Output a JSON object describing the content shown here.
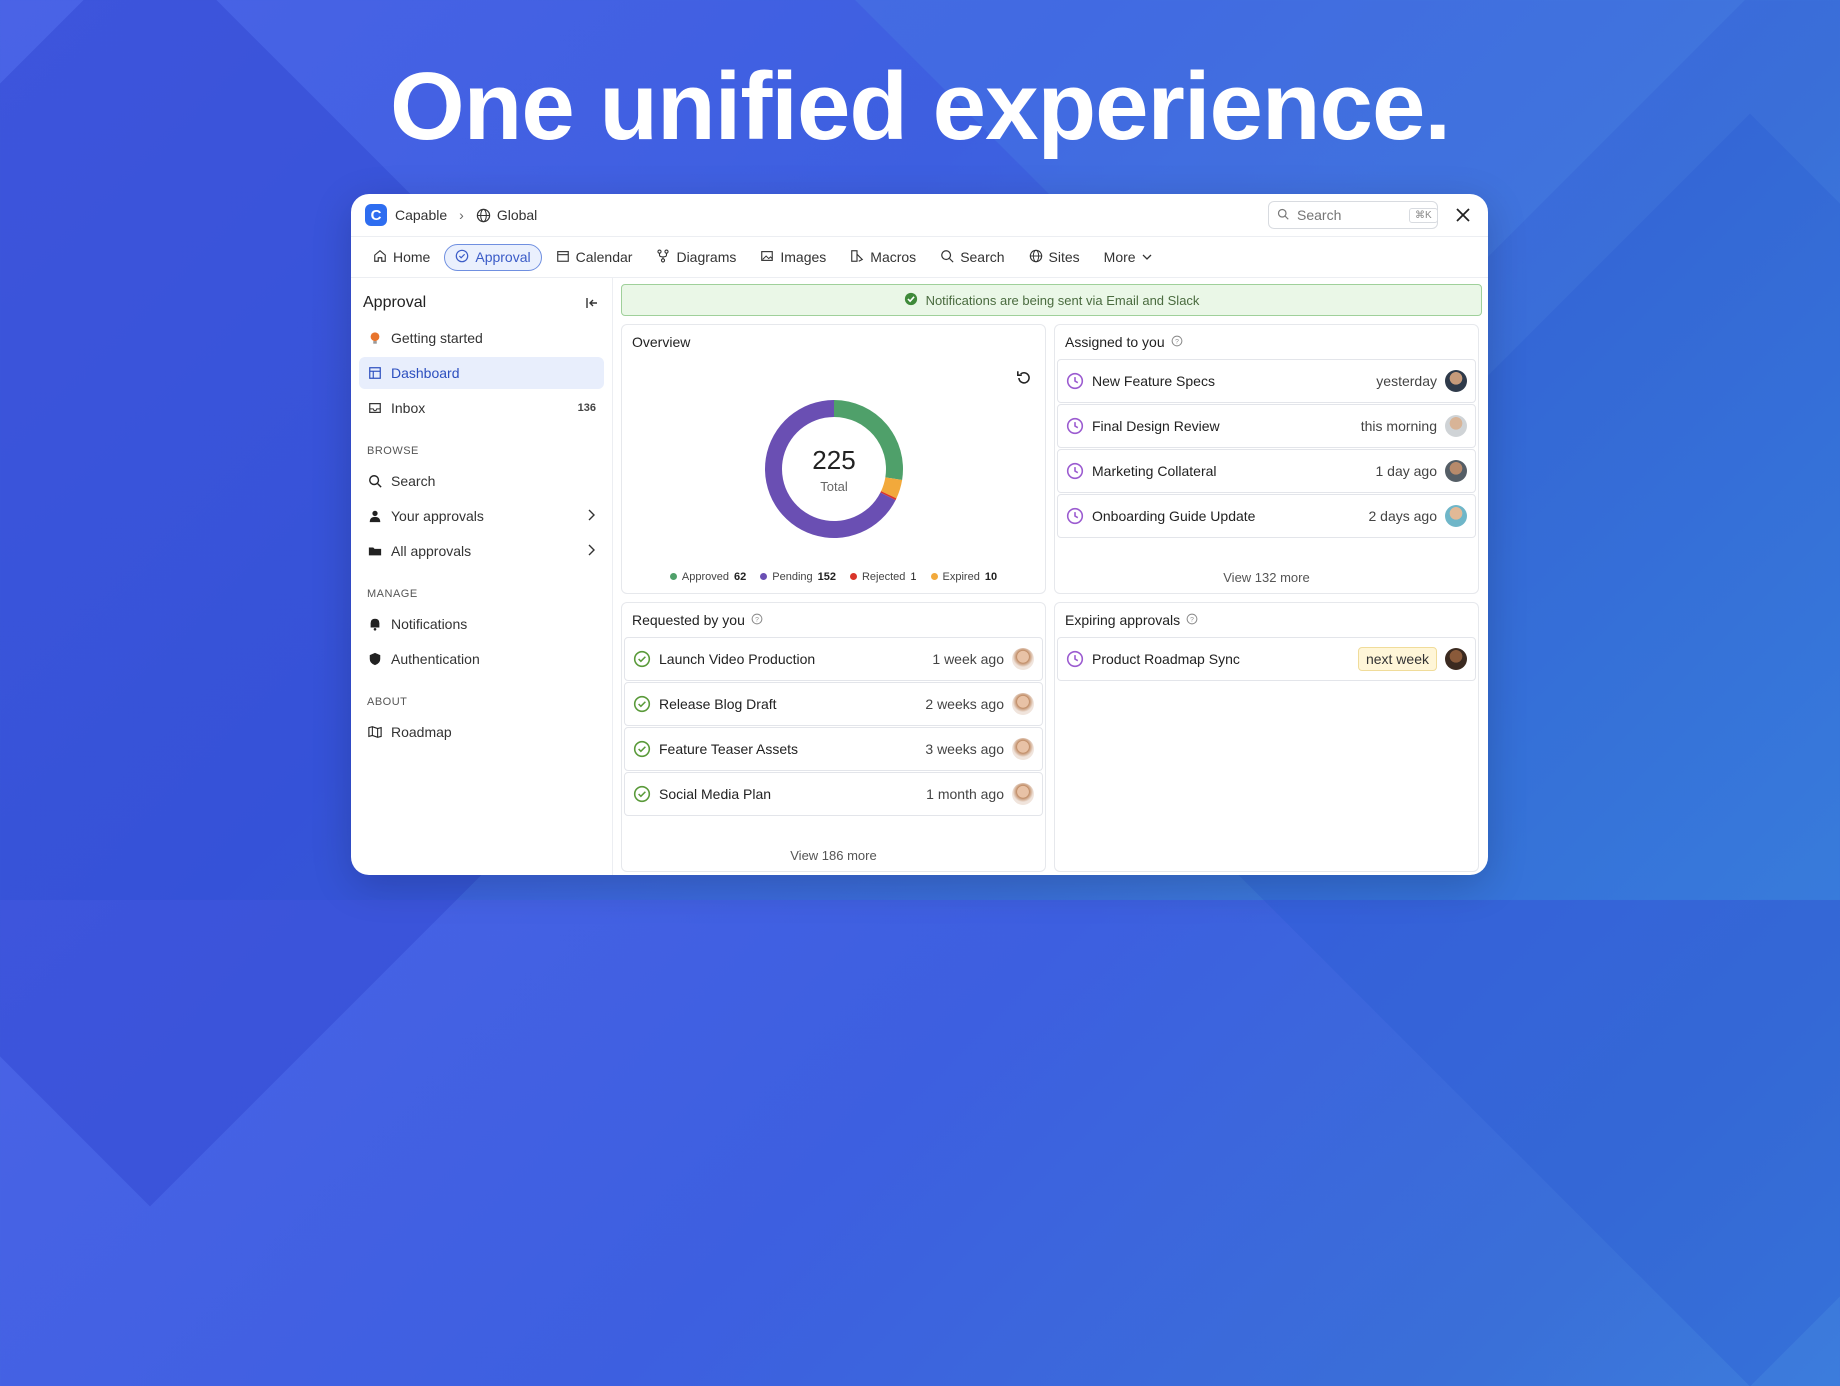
{
  "headline": "One unified experience.",
  "titlebar": {
    "app": "Capable",
    "logo_letter": "C",
    "space": "Global",
    "search_placeholder": "Search",
    "shortcut": "⌘K"
  },
  "nav": {
    "home": "Home",
    "approval": "Approval",
    "calendar": "Calendar",
    "diagrams": "Diagrams",
    "images": "Images",
    "macros": "Macros",
    "search": "Search",
    "sites": "Sites",
    "more": "More"
  },
  "sidebar": {
    "title": "Approval",
    "getting_started": "Getting started",
    "dashboard": "Dashboard",
    "inbox": "Inbox",
    "inbox_count": "136",
    "browse_label": "BROWSE",
    "search": "Search",
    "your_approvals": "Your approvals",
    "all_approvals": "All approvals",
    "manage_label": "MANAGE",
    "notifications": "Notifications",
    "authentication": "Authentication",
    "about_label": "ABOUT",
    "roadmap": "Roadmap"
  },
  "banner": "Notifications are being sent via Email and Slack",
  "overview": {
    "title": "Overview",
    "total": "225",
    "total_label": "Total",
    "legend": {
      "approved": {
        "label": "Approved",
        "value": 62,
        "color": "#4fa06a"
      },
      "pending": {
        "label": "Pending",
        "value": 152,
        "color": "#6a4fb3"
      },
      "rejected": {
        "label": "Rejected",
        "value": 1,
        "color": "#d9352a"
      },
      "expired": {
        "label": "Expired",
        "value": 10,
        "color": "#f2a93b"
      }
    }
  },
  "assigned": {
    "title": "Assigned to you",
    "rows": [
      {
        "title": "New Feature Specs",
        "when": "yesterday"
      },
      {
        "title": "Final Design Review",
        "when": "this morning"
      },
      {
        "title": "Marketing Collateral",
        "when": "1 day ago"
      },
      {
        "title": "Onboarding Guide Update",
        "when": "2 days ago"
      }
    ],
    "more": "View 132 more"
  },
  "requested": {
    "title": "Requested by you",
    "rows": [
      {
        "title": "Launch Video Production",
        "when": "1 week ago"
      },
      {
        "title": "Release Blog Draft",
        "when": "2 weeks ago"
      },
      {
        "title": "Feature Teaser Assets",
        "when": "3 weeks ago"
      },
      {
        "title": "Social Media Plan",
        "when": "1 month ago"
      }
    ],
    "more": "View 186 more"
  },
  "expiring": {
    "title": "Expiring approvals",
    "rows": [
      {
        "title": "Product Roadmap Sync",
        "when": "next week"
      }
    ]
  }
}
